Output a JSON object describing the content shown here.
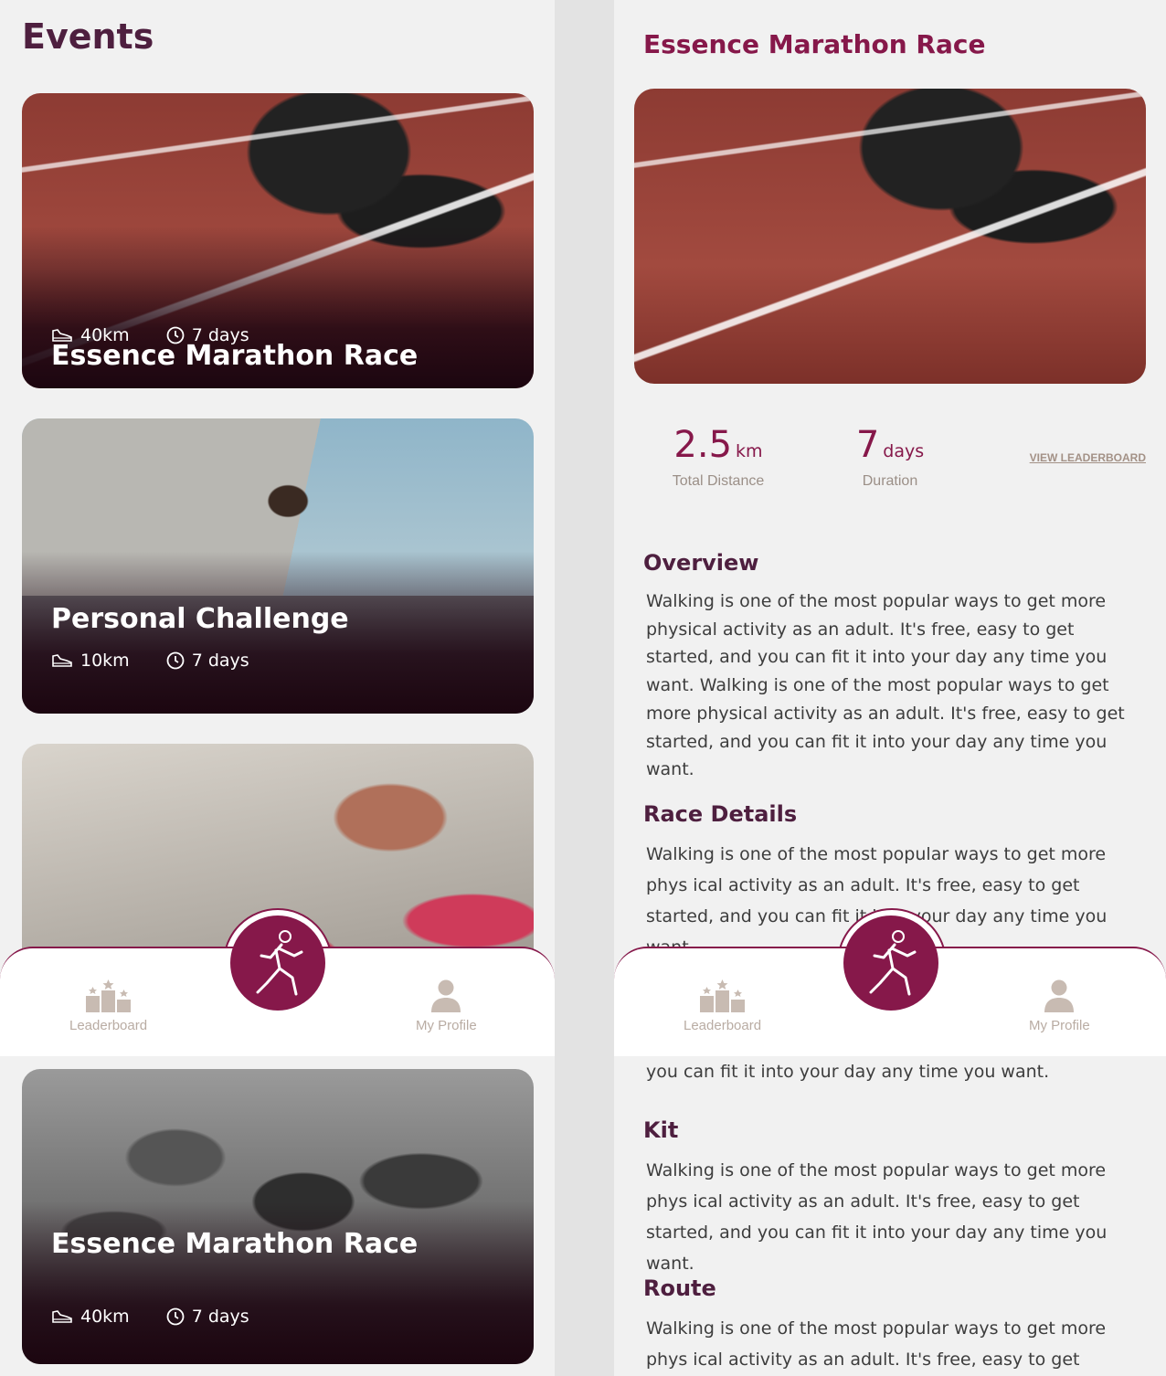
{
  "events_screen": {
    "title": "Events",
    "cards": [
      {
        "title": "Essence Marathon Race",
        "distance": "40km",
        "duration": "7 days"
      },
      {
        "title": "Personal Challenge",
        "distance": "10km",
        "duration": "7 days"
      },
      {
        "title": "",
        "distance": "",
        "duration": ""
      },
      {
        "title": "Essence Marathon Race",
        "distance": "40km",
        "duration": "7 days"
      }
    ]
  },
  "nav": {
    "left_label": "Leaderboard",
    "right_label": "My Profile"
  },
  "detail_screen": {
    "title": "Essence Marathon Race",
    "stats": {
      "distance_value": "2.5",
      "distance_unit": "km",
      "distance_label": "Total Distance",
      "duration_value": "7",
      "duration_unit": "days",
      "duration_label": "Duration"
    },
    "leaderboard_link": "VIEW LEADERBOARD",
    "overview_title": "Overview",
    "overview_text": "Walking is one of the most popular ways to get more physical activity as an adult. It's free, easy to get started, and you can fit it into your day any time you want. Walking is one of the most popular ways to get more physical activity as an adult. It's free, easy to get started, and you can fit it into your day any time you want.",
    "race_details_title": "Race Details",
    "race_details_text": "Walking is one of the most popular ways to get more phys ical activity as an adult. It's free, easy to get started, and you can fit it into your day any time you want.",
    "race_details_overflow": "you can fit it into your day any time you want.",
    "kit_title": "Kit",
    "kit_text": "Walking is one of the most popular ways to get more phys ical activity as an adult. It's free, easy to get started, and you can fit it into your day any time you want.",
    "route_title": "Route",
    "route_text": "Walking is one of the most popular ways to get more phys ical activity as an adult. It's free, easy to get started, and"
  },
  "colors": {
    "brand": "#86184a",
    "heading": "#4e1f3f",
    "muted": "#b9aca3",
    "background": "#f1f1f1"
  },
  "icons": [
    "shoe-icon",
    "clock-icon",
    "podium-icon",
    "profile-icon",
    "runner-icon"
  ]
}
